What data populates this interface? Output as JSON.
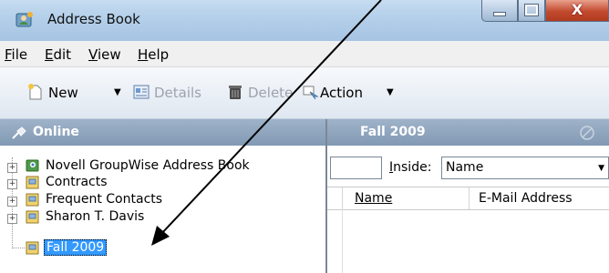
{
  "window": {
    "title": "Address Book",
    "close_symbol": "X"
  },
  "menu": [
    {
      "accel": "F",
      "rest": "ile"
    },
    {
      "accel": "E",
      "rest": "dit"
    },
    {
      "accel": "V",
      "rest": "iew"
    },
    {
      "accel": "H",
      "rest": "elp"
    }
  ],
  "toolbar": {
    "new": "New",
    "details": "Details",
    "delete": "Delete",
    "action": "Action"
  },
  "left_pane": {
    "header": "Online"
  },
  "tree": [
    {
      "label": "Novell GroupWise Address Book"
    },
    {
      "label": "Contracts"
    },
    {
      "label": "Frequent Contacts"
    },
    {
      "label": "Sharon T. Davis"
    },
    {
      "label": "Fall 2009",
      "selected": true
    }
  ],
  "right_pane": {
    "header": "Fall 2009",
    "inside_label": "Inside:",
    "inside_accel": "I",
    "inside_rest": "nside:",
    "inside_value": "Name",
    "columns": [
      "Name",
      "E-Mail Address"
    ]
  },
  "colors": {
    "selection": "#3399ff",
    "header": "#8fa6bf"
  }
}
